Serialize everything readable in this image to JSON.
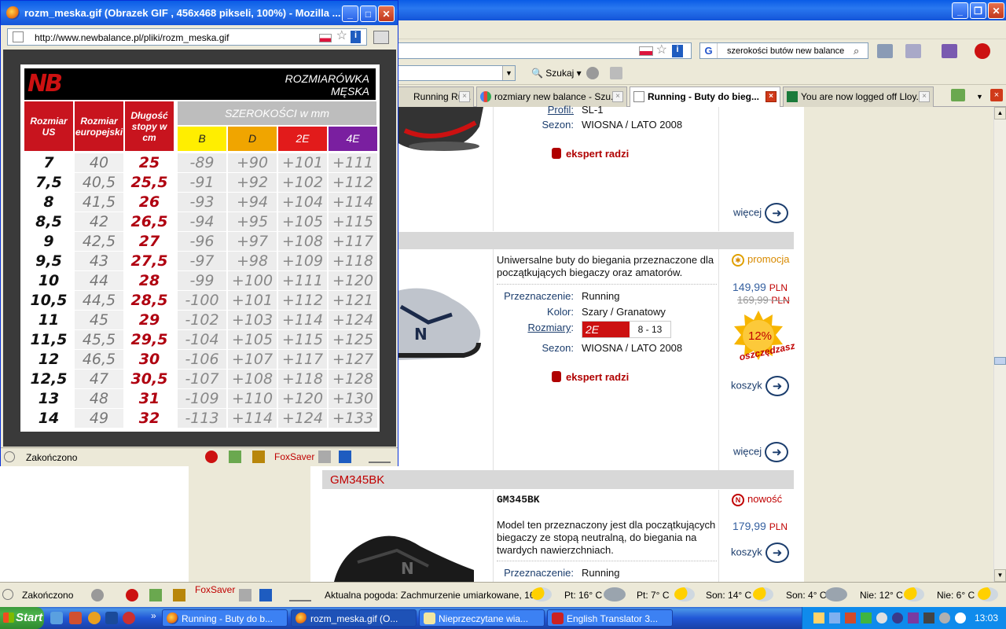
{
  "popup": {
    "title": "rozm_meska.gif (Obrazek GIF , 456x468 pikseli, 100%) - Mozilla ...",
    "url": "http://www.newbalance.pl/pliki/rozm_meska.gif",
    "status": "Zakończono",
    "foxsaver": "FoxSaver"
  },
  "sizechart": {
    "title_line1": "ROZMIARÓWKA",
    "title_line2": "MĘSKA",
    "col_us": "Rozmiar US",
    "col_eu": "Rozmiar europejski",
    "col_cm": "Długość stopy w cm",
    "widths_title": "SZEROKOŚCI w mm",
    "widths": [
      {
        "label": "B",
        "bg": "#ffee00",
        "fg": "#222222"
      },
      {
        "label": "D",
        "bg": "#f0a500",
        "fg": "#222222"
      },
      {
        "label": "2E",
        "bg": "#e21b1b",
        "fg": "#ffffff"
      },
      {
        "label": "4E",
        "bg": "#7a1fa0",
        "fg": "#ffffff"
      }
    ],
    "rows": [
      {
        "us": "7",
        "eu": "40",
        "cm": "25",
        "b": "-89",
        "d": "+90",
        "e2": "+101",
        "e4": "+111"
      },
      {
        "us": "7,5",
        "eu": "40,5",
        "cm": "25,5",
        "b": "-91",
        "d": "+92",
        "e2": "+102",
        "e4": "+112"
      },
      {
        "us": "8",
        "eu": "41,5",
        "cm": "26",
        "b": "-93",
        "d": "+94",
        "e2": "+104",
        "e4": "+114"
      },
      {
        "us": "8,5",
        "eu": "42",
        "cm": "26,5",
        "b": "-94",
        "d": "+95",
        "e2": "+105",
        "e4": "+115"
      },
      {
        "us": "9",
        "eu": "42,5",
        "cm": "27",
        "b": "-96",
        "d": "+97",
        "e2": "+108",
        "e4": "+117"
      },
      {
        "us": "9,5",
        "eu": "43",
        "cm": "27,5",
        "b": "-97",
        "d": "+98",
        "e2": "+109",
        "e4": "+118"
      },
      {
        "us": "10",
        "eu": "44",
        "cm": "28",
        "b": "-99",
        "d": "+100",
        "e2": "+111",
        "e4": "+120"
      },
      {
        "us": "10,5",
        "eu": "44,5",
        "cm": "28,5",
        "b": "-100",
        "d": "+101",
        "e2": "+112",
        "e4": "+121"
      },
      {
        "us": "11",
        "eu": "45",
        "cm": "29",
        "b": "-102",
        "d": "+103",
        "e2": "+114",
        "e4": "+124"
      },
      {
        "us": "11,5",
        "eu": "45,5",
        "cm": "29,5",
        "b": "-104",
        "d": "+105",
        "e2": "+115",
        "e4": "+125"
      },
      {
        "us": "12",
        "eu": "46,5",
        "cm": "30",
        "b": "-106",
        "d": "+107",
        "e2": "+117",
        "e4": "+127"
      },
      {
        "us": "12,5",
        "eu": "47",
        "cm": "30,5",
        "b": "-107",
        "d": "+108",
        "e2": "+118",
        "e4": "+128"
      },
      {
        "us": "13",
        "eu": "48",
        "cm": "31",
        "b": "-109",
        "d": "+110",
        "e2": "+120",
        "e4": "+130"
      },
      {
        "us": "14",
        "eu": "49",
        "cm": "32",
        "b": "-113",
        "d": "+114",
        "e2": "+124",
        "e4": "+133"
      }
    ]
  },
  "browser": {
    "search_text": "szerokości butów new balance",
    "szukaj": "Szukaj",
    "tabs": [
      {
        "label": "Running Ru..."
      },
      {
        "label": "rozmiary new balance - Szu..."
      },
      {
        "label": "Running - Buty do bieg..."
      },
      {
        "label": "You are now logged off Lloy..."
      }
    ]
  },
  "products": {
    "p1": {
      "profil_label": "Profil:",
      "profil_value": "SL-1",
      "sezon_label": "Sezon:",
      "sezon_value": "WIOSNA / LATO 2008",
      "ekspert": "ekspert radzi",
      "wiecej": "więcej"
    },
    "p2": {
      "description": "Uniwersalne buty do biegania przeznaczone dla początkujących biegaczy oraz amatorów.",
      "przeznaczenie_label": "Przeznaczenie:",
      "przeznaczenie_value": "Running",
      "kolor_label": "Kolor:",
      "kolor_value": "Szary / Granatowy",
      "rozmiary_label": "Rozmiary",
      "rozmiary_width": "2E",
      "rozmiary_range": "8 - 13",
      "sezon_label": "Sezon:",
      "sezon_value": "WIOSNA / LATO 2008",
      "ekspert": "ekspert radzi",
      "promo": "promocja",
      "price": "149,99",
      "old_price": "169,99",
      "currency": "PLN",
      "discount": "12%",
      "discount_label": "oszczędzasz",
      "koszyk": "koszyk",
      "wiecej": "więcej"
    },
    "p3": {
      "code": "GM345BK",
      "name": "GM345BK",
      "description": "Model ten przeznaczony jest dla początkujących biegaczy ze stopą neutralną, do biegania na twardych nawierzchniach.",
      "przeznaczenie_label": "Przeznaczenie:",
      "przeznaczenie_value": "Running",
      "badge": "nowość",
      "price": "179,99",
      "currency": "PLN",
      "koszyk": "koszyk"
    }
  },
  "statusbar": {
    "status": "Zakończono",
    "foxsaver": "FoxSaver",
    "weather_now": "Aktualna pogoda: Zachmurzenie umiarkowane, 16° C",
    "forecast": [
      {
        "label": "Pt: 16° C"
      },
      {
        "label": "Pt: 7° C"
      },
      {
        "label": "Son: 14° C"
      },
      {
        "label": "Son: 4° C"
      },
      {
        "label": "Nie: 12° C"
      },
      {
        "label": "Nie: 6° C"
      }
    ]
  },
  "taskbar": {
    "start": "Start",
    "tasks": [
      {
        "label": "Running - Buty do b..."
      },
      {
        "label": "rozm_meska.gif (O..."
      },
      {
        "label": "Nieprzeczytane wia..."
      },
      {
        "label": "English Translator 3..."
      }
    ],
    "clock": "13:03"
  }
}
